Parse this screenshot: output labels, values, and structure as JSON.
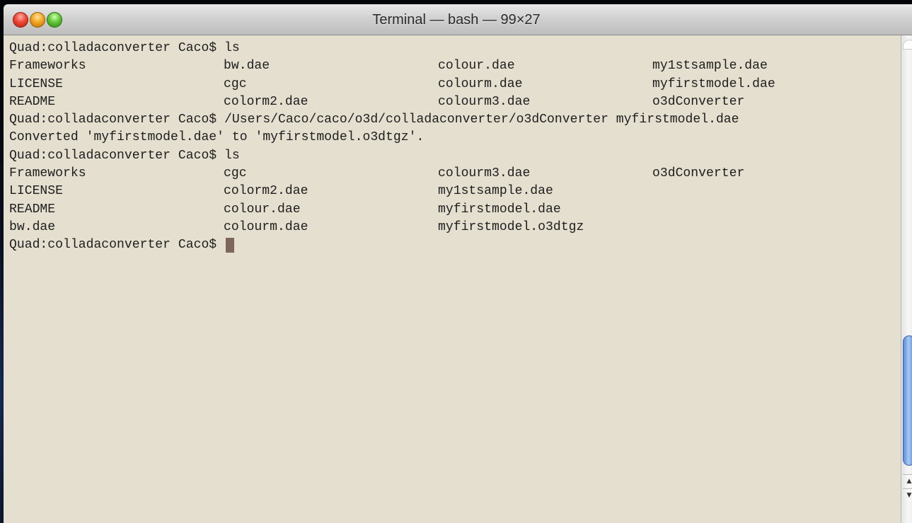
{
  "window": {
    "title": "Terminal — bash — 99×27"
  },
  "terminal": {
    "lines": [
      {
        "type": "text",
        "text": "Quad:colladaconverter Caco$ ls"
      },
      {
        "type": "row",
        "cells": [
          "Frameworks",
          "bw.dae",
          "colour.dae",
          "my1stsample.dae"
        ]
      },
      {
        "type": "row",
        "cells": [
          "LICENSE",
          "cgc",
          "colourm.dae",
          "myfirstmodel.dae"
        ]
      },
      {
        "type": "row",
        "cells": [
          "README",
          "colorm2.dae",
          "colourm3.dae",
          "o3dConverter"
        ]
      },
      {
        "type": "text",
        "text": "Quad:colladaconverter Caco$ /Users/Caco/caco/o3d/colladaconverter/o3dConverter myfirstmodel.dae"
      },
      {
        "type": "text",
        "text": "Converted 'myfirstmodel.dae' to 'myfirstmodel.o3dtgz'."
      },
      {
        "type": "text",
        "text": "Quad:colladaconverter Caco$ ls"
      },
      {
        "type": "row",
        "cells": [
          "Frameworks",
          "cgc",
          "colourm3.dae",
          "o3dConverter"
        ]
      },
      {
        "type": "row",
        "cells": [
          "LICENSE",
          "colorm2.dae",
          "my1stsample.dae",
          ""
        ]
      },
      {
        "type": "row",
        "cells": [
          "README",
          "colour.dae",
          "myfirstmodel.dae",
          ""
        ]
      },
      {
        "type": "row",
        "cells": [
          "bw.dae",
          "colourm.dae",
          "myfirstmodel.o3dtgz",
          ""
        ]
      }
    ],
    "prompt": "Quad:colladaconverter Caco$ "
  },
  "colors": {
    "terminal_background": "#e5dfd0",
    "terminal_text": "#1e1e1e",
    "cursor": "#7d675c",
    "scroll_thumb": "#6f9ee0"
  },
  "icons": {
    "close": "close-button",
    "minimize": "minimize-button",
    "zoom": "zoom-button",
    "scroll_up": "▲",
    "scroll_down": "▼"
  }
}
